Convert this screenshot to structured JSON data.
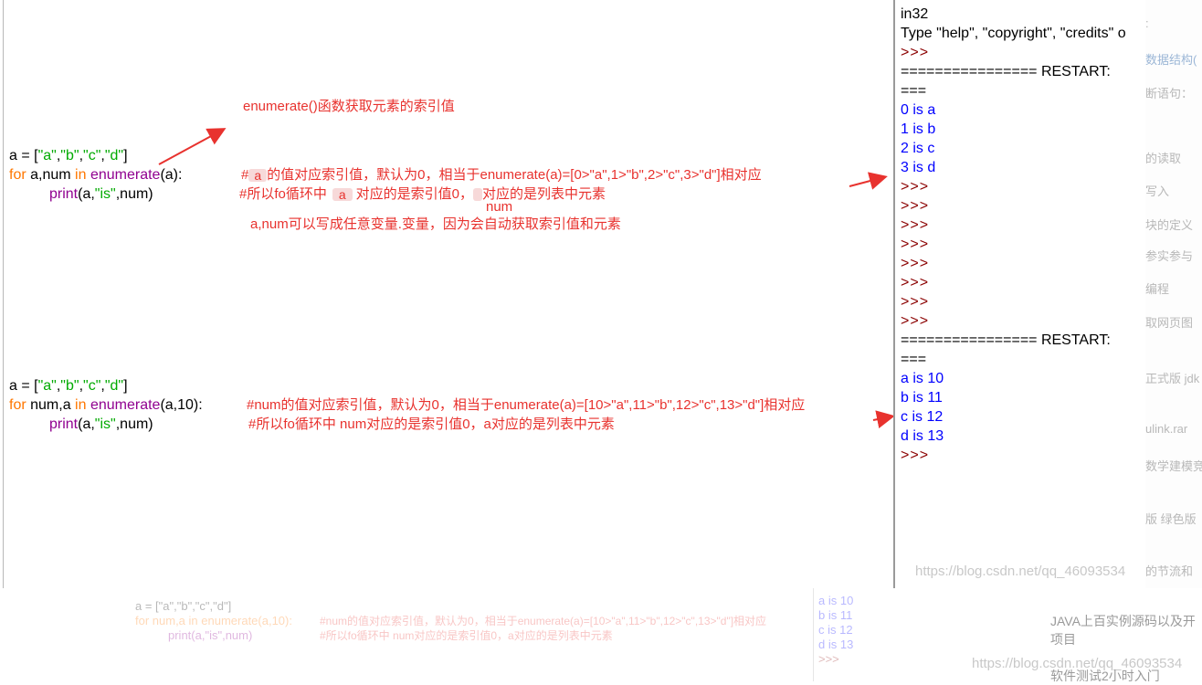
{
  "editor": {
    "block1": {
      "line1": [
        "a = [",
        "\"a\"",
        ",",
        "\"b\"",
        ",",
        "\"c\"",
        ",",
        "\"d\"",
        "]"
      ],
      "line2": {
        "kw1": "for",
        "vars": " a,num ",
        "kw2": "in",
        "fn": "enumerate",
        "args": "(a):"
      },
      "line3": {
        "fn": "print",
        "args_pre": "(a,",
        "str": "\"is\"",
        "args_post": ",num)"
      }
    },
    "block2": {
      "line1": [
        "a = [",
        "\"a\"",
        ",",
        "\"b\"",
        ",",
        "\"c\"",
        ",",
        "\"d\"",
        "]"
      ],
      "line2": {
        "kw1": "for",
        "vars": " num,a ",
        "kw2": "in",
        "fn": "enumerate",
        "args": "(a,10):"
      },
      "line3": {
        "fn": "print",
        "args_pre": "(a,",
        "str": "\"is\"",
        "args_post": ",num)"
      }
    },
    "notes": {
      "title": "enumerate()函数获取元素的索引值",
      "b1_c1_pre": "#",
      "b1_c1_hidden": "a",
      "b1_c1_post": "的值对应索引值，默认为0，相当于enumerate(a)=[0>\"a\",1>\"b\",2>\"c\",3>\"d\"]相对应",
      "b1_c2_pre": "#所以fo循环中",
      "b1_c2_hidden": "a",
      "b1_c2_mid": "对应的是索引值0，",
      "b1_c2_post": "对应的是列表中元素",
      "b1_num": "num",
      "b1_c3": "a,num可以写成任意变量.变量，因为会自动获取索引值和元素",
      "b2_c1": "#num的值对应索引值，默认为0，相当于enumerate(a)=[10>\"a\",11>\"b\",12>\"c\",13>\"d\"]相对应",
      "b2_c2": "#所以fo循环中 num对应的是索引值0，a对应的是列表中元素"
    }
  },
  "shell": {
    "lines": [
      {
        "text": "in32",
        "style": "black"
      },
      {
        "text": "Type \"help\", \"copyright\", \"credits\" o",
        "style": "black"
      },
      {
        "text": ">>>",
        "style": "prompt"
      },
      {
        "text": "================ RESTART:",
        "style": "black"
      },
      {
        "text": "===",
        "style": "black"
      },
      {
        "text": "0 is a",
        "style": "blue"
      },
      {
        "text": "1 is b",
        "style": "blue"
      },
      {
        "text": "2 is c",
        "style": "blue"
      },
      {
        "text": "3 is d",
        "style": "blue"
      },
      {
        "text": ">>>",
        "style": "prompt"
      },
      {
        "text": ">>>",
        "style": "prompt"
      },
      {
        "text": ">>>",
        "style": "prompt"
      },
      {
        "text": ">>>",
        "style": "prompt"
      },
      {
        "text": ">>>",
        "style": "prompt"
      },
      {
        "text": ">>>",
        "style": "prompt"
      },
      {
        "text": ">>>",
        "style": "prompt"
      },
      {
        "text": ">>>",
        "style": "prompt"
      },
      {
        "text": "================ RESTART:",
        "style": "black"
      },
      {
        "text": "===",
        "style": "black"
      },
      {
        "text": "a is 10",
        "style": "blue"
      },
      {
        "text": "b is 11",
        "style": "blue"
      },
      {
        "text": "c is 12",
        "style": "blue"
      },
      {
        "text": "d is 13",
        "style": "blue"
      },
      {
        "text": ">>>",
        "style": "prompt"
      }
    ]
  },
  "sidebar": {
    "items": [
      ":",
      "数据结构(",
      "断语句：",
      "",
      "的读取",
      "写入",
      "块的定义",
      "参实参与",
      "编程",
      "取网页图",
      "正式版 jdk",
      "ulink.rar",
      "数学建模竞",
      "版 绿色版",
      "的节流和"
    ]
  },
  "bottom": {
    "faded_code_1": "a = [\"a\",\"b\",\"c\",\"d\"]",
    "faded_code_2": "for num,a in enumerate(a,10):",
    "faded_code_3": "print(a,\"is\",num)",
    "faded_note_1": "#num的值对应索引值，默认为0，相当于enumerate(a)=[10>\"a\",11>\"b\",12>\"c\",13>\"d\"]相对应",
    "faded_note_2": "#所以fo循环中 num对应的是索引值0，a对应的是列表中元素",
    "faded_shell": [
      "a is 10",
      "b is 11",
      "c is 12",
      "d is 13",
      ">>>"
    ],
    "watermark_1": "https://blog.csdn.net/qq_46093534",
    "watermark_2": "https://blog.csdn.net/qq_46093534",
    "right_1": "JAVA上百实例源码以及开",
    "right_2": "项目",
    "right_3": "软件测试2小时入门"
  },
  "colors": {
    "keyword": "#ff7700",
    "builtin": "#900090",
    "string": "#00aa00",
    "annotation": "#e8322e",
    "output": "#0000ff"
  }
}
